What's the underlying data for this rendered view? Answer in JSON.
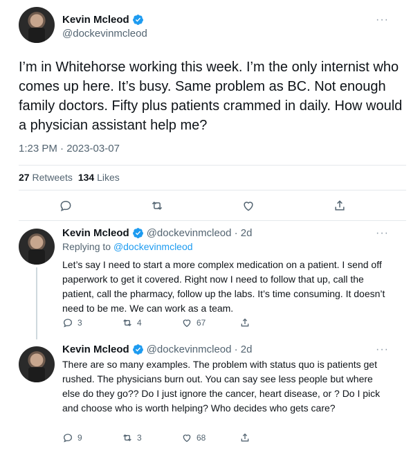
{
  "main_tweet": {
    "author_name": "Kevin Mcleod",
    "author_handle": "@dockevinmcleod",
    "text": "I’m in Whitehorse working this week. I’m the only internist who comes up here. It’s busy. Same problem as BC. Not enough family doctors. Fifty plus patients crammed in daily. How would a physician assistant help me?",
    "timestamp": "1:23 PM · 2023-03-07",
    "retweets_count": "27",
    "retweets_label": "Retweets",
    "likes_count": "134",
    "likes_label": "Likes",
    "more_icon": "···"
  },
  "replies": [
    {
      "author_name": "Kevin Mcleod",
      "author_handle": "@dockevinmcleod · 2d",
      "replying_prefix": "Replying to",
      "replying_to": "@dockevinmcleod",
      "text": "Let’s say I need to start a more complex medication on a patient. I send off paperwork to get it covered. Right now I need to follow that up, call the patient, call the pharmacy, follow up the labs. It’s time consuming. It doesn’t need to be me. We can work as a team.",
      "reply_count": "3",
      "retweet_count": "4",
      "like_count": "67",
      "more_icon": "···"
    },
    {
      "author_name": "Kevin Mcleod",
      "author_handle": "@dockevinmcleod · 2d",
      "text": "There are so many examples. The problem with status quo is patients get rushed. The physicians burn out. You can say see less people but where else do they go?? Do I just ignore the cancer, heart disease, or ? Do I pick and choose who is worth helping? Who decides who gets care?",
      "reply_count": "9",
      "retweet_count": "3",
      "like_count": "68",
      "more_icon": "···"
    }
  ],
  "colors": {
    "verified": "#1d9bf0",
    "link": "#1d9bf0",
    "secondary_text": "#536471"
  },
  "icons": {
    "verified": "verified-badge-icon",
    "reply": "reply-icon",
    "retweet": "retweet-icon",
    "like": "heart-icon",
    "share": "share-icon",
    "more": "more-icon"
  }
}
